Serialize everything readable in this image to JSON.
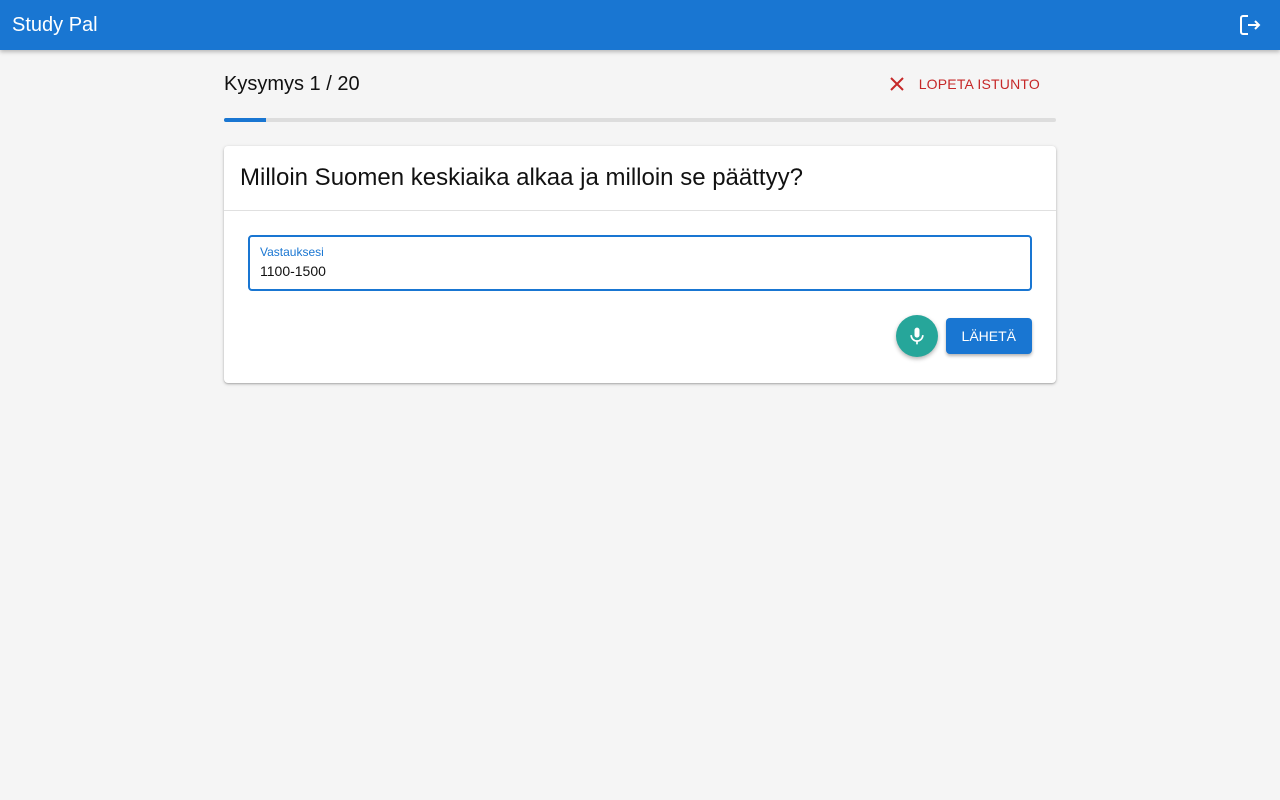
{
  "app": {
    "title": "Study Pal",
    "brand_color": "#1976d2"
  },
  "session": {
    "question_counter": "Kysymys 1 / 20",
    "end_session_label": "LOPETA ISTUNTO",
    "end_session_icon": "close-icon",
    "progress_fraction": 0.05
  },
  "question": {
    "text": "Milloin Suomen keskiaika alkaa ja milloin se päättyy?"
  },
  "answer": {
    "label": "Vastauksesi",
    "value": "1100-1500"
  },
  "actions": {
    "mic_icon": "microphone-icon",
    "send_label": "LÄHETÄ"
  },
  "icons": {
    "logout": "logout-icon"
  }
}
